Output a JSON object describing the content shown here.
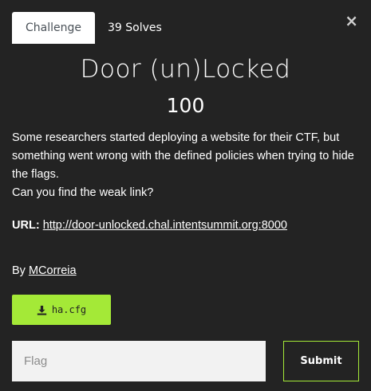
{
  "tabs": [
    {
      "label": "Challenge",
      "active": true
    },
    {
      "label": "39 Solves",
      "active": false
    }
  ],
  "close_label": "×",
  "challenge": {
    "title": "Door (un)Locked",
    "points": "100",
    "description_lines": [
      "Some researchers started deploying a website for their CTF, but something went wrong with the defined policies when trying to hide the flags.",
      "Can you find the weak link?"
    ],
    "url_label": "URL",
    "url_separator": ":",
    "url": "http://door-unlocked.chal.intentsummit.org:8000",
    "author_prefix": "By",
    "author": "MCorreia"
  },
  "file": {
    "name": "ha.cfg",
    "icon": "download-icon"
  },
  "flag_input": {
    "placeholder": "Flag",
    "value": ""
  },
  "submit_label": "Submit",
  "colors": {
    "background": "#232323",
    "accent": "#a4e937",
    "tab_active_bg": "#ffffff"
  }
}
